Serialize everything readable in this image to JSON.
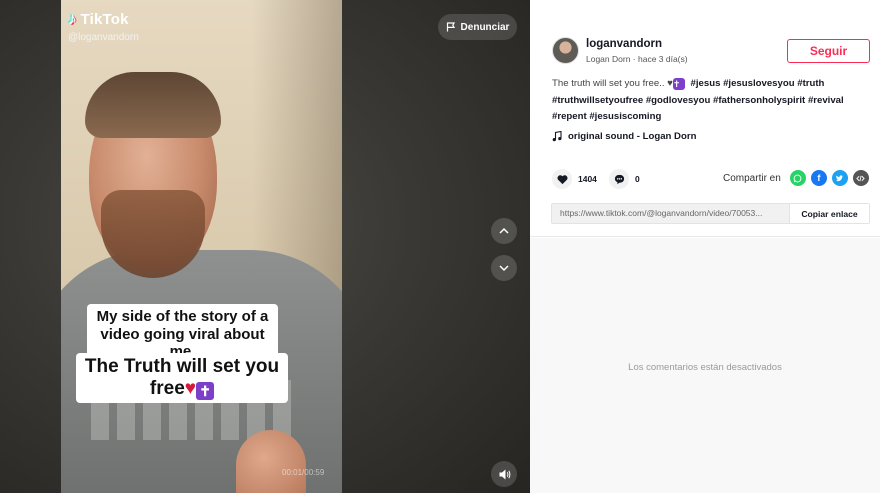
{
  "video": {
    "brand": "TikTok",
    "handle": "@loganvandorn",
    "report_label": "Denunciar",
    "caption_line1": "My side of the story of a video going viral about me.",
    "caption_line2a": "The Truth will set you",
    "caption_line2b": "free",
    "timestamp": "00:01/00:59",
    "icons": {
      "logo": "tiktok-note-icon",
      "report": "flag-icon",
      "prev": "chevron-up-icon",
      "next": "chevron-down-icon",
      "sound": "speaker-icon"
    }
  },
  "post": {
    "username": "loganvandorn",
    "display_name": "Logan Dorn",
    "posted": "hace 3 día(s)",
    "follow_label": "Seguir",
    "description_text": "The truth will set you free.. ♥",
    "hashtags": [
      "#jesus",
      "#jesuslovesyou",
      "#truth",
      "#truthwillsetyoufree",
      "#godlovesyou",
      "#fathersonholyspirit",
      "#revival",
      "#repent",
      "#jesusiscoming"
    ],
    "sound": "original sound - Logan Dorn",
    "likes": "1404",
    "comments": "0",
    "share_label": "Compartir en",
    "link": "https://www.tiktok.com/@loganvandorn/video/70053...",
    "copy_label": "Copiar enlace",
    "comments_disabled": "Los comentarios están desactivados"
  },
  "colors": {
    "accent": "#fe2c55",
    "whatsapp": "#25d366",
    "facebook": "#1877f2",
    "twitter": "#1da1f2"
  }
}
